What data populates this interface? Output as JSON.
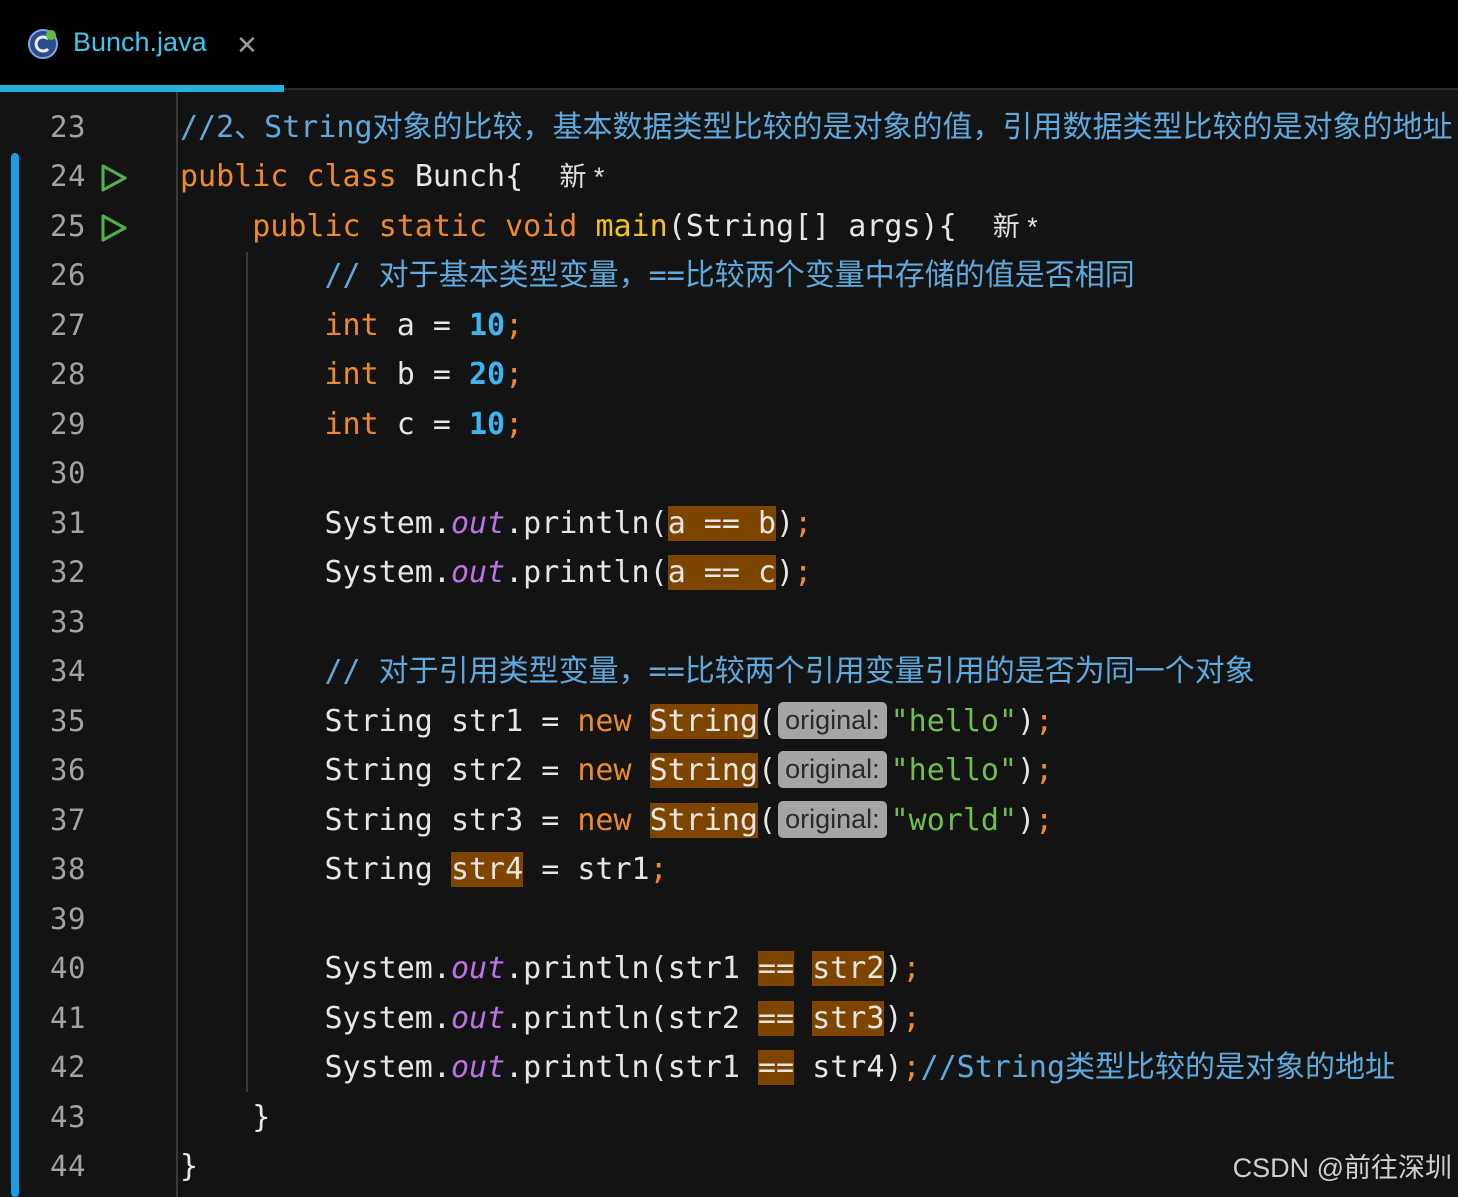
{
  "tab": {
    "file_name": "Bunch.java",
    "close_glyph": "✕"
  },
  "editor": {
    "author_marker": "新 *",
    "lines": [
      {
        "no": "23"
      },
      {
        "no": "24"
      },
      {
        "no": "25"
      },
      {
        "no": "26"
      },
      {
        "no": "27"
      },
      {
        "no": "28"
      },
      {
        "no": "29"
      },
      {
        "no": "30"
      },
      {
        "no": "31"
      },
      {
        "no": "32"
      },
      {
        "no": "33"
      },
      {
        "no": "34"
      },
      {
        "no": "35"
      },
      {
        "no": "36"
      },
      {
        "no": "37"
      },
      {
        "no": "38"
      },
      {
        "no": "39"
      },
      {
        "no": "40"
      },
      {
        "no": "41"
      },
      {
        "no": "42"
      },
      {
        "no": "43"
      },
      {
        "no": "44"
      }
    ],
    "code": {
      "l23_comment": "//2、String对象的比较，基本数据类型比较的是对象的值，引用数据类型比较的是对象的地址",
      "kw_public": "public",
      "kw_class": "class",
      "kw_static": "static",
      "kw_void": "void",
      "kw_int": "int",
      "kw_new": "new",
      "class_name": "Bunch",
      "method_main": "main",
      "main_params": "(String[] args){",
      "brace_open": "{",
      "brace_close": "}",
      "l26_comment": "// 对于基本类型变量，==比较两个变量中存储的值是否相同",
      "var_a": "a",
      "var_b": "b",
      "var_c": "c",
      "assign": " = ",
      "num_10": "10",
      "num_20": "20",
      "semi": ";",
      "system": "System.",
      "out": "out",
      "println": ".println(",
      "eq": " == ",
      "eq_op": "==",
      "close_paren": ")",
      "l34_comment": "// 对于引用类型变量，==比较两个引用变量引用的是否为同一个对象",
      "type_string": "String",
      "str1": "str1",
      "str2": "str2",
      "str3": "str3",
      "str4": "str4",
      "paren_open": "(",
      "hint_original": "original:",
      "lit_hello": "\"hello\"",
      "lit_world": "\"world\"",
      "l42_comment": "//String类型比较的是对象的地址"
    }
  },
  "watermark": "CSDN @前往深圳",
  "colors": {
    "keyword": "#ee8a2e",
    "comment": "#5ea9dd",
    "number": "#3bb6f2",
    "string": "#6fc04a",
    "highlight": "#7d4500",
    "accent": "#23b4de"
  }
}
